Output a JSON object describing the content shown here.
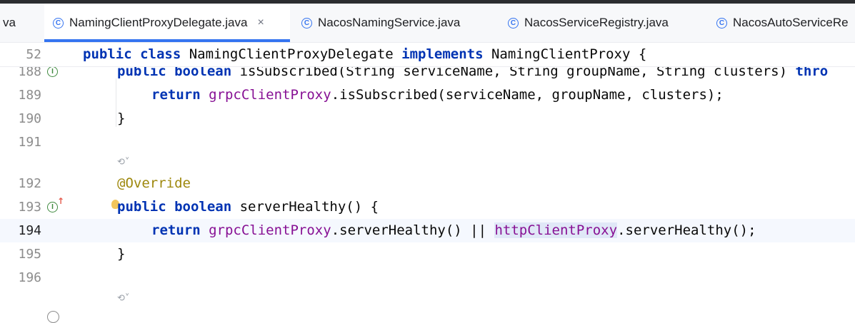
{
  "tabs": [
    {
      "label": "va",
      "icon": null,
      "active": false
    },
    {
      "label": "NamingClientProxyDelegate.java",
      "icon": "class-icon",
      "active": true,
      "close": "×"
    },
    {
      "label": "NacosNamingService.java",
      "icon": "class-icon",
      "active": false
    },
    {
      "label": "NacosServiceRegistry.java",
      "icon": "class-icon",
      "active": false
    },
    {
      "label": "NacosAutoServiceRe",
      "icon": "class-icon",
      "active": false
    }
  ],
  "class_icon_glyph": "C",
  "gutter_icon_glyph": "I",
  "editor": {
    "sticky_line": {
      "num": "52",
      "kw1": "public class",
      "name": " NamingClientProxyDelegate ",
      "kw2": "implements",
      "rest": " NamingClientProxy {"
    },
    "lines": [
      {
        "num": "188",
        "kw": "public boolean",
        "rest": " isSubscribed(String serviceName, String groupName, String clusters) ",
        "kw_tail": "thro"
      },
      {
        "num": "189",
        "kw": "return",
        "field": "grpcClientProxy",
        "rest": ".isSubscribed(serviceName, groupName, clusters);"
      },
      {
        "num": "190",
        "text": "}"
      },
      {
        "num": "191",
        "text": ""
      },
      {
        "num": "192",
        "annotation": "@Override"
      },
      {
        "num": "193",
        "kw": "public boolean",
        "rest": " serverHealthy() {"
      },
      {
        "num": "194",
        "kw": "return",
        "field": "grpcClientProxy",
        "mid": ".serverHealthy() || ",
        "field2": "httpClientProxy",
        "rest": ".serverHealthy();"
      },
      {
        "num": "195",
        "text": "}"
      },
      {
        "num": "196",
        "text": ""
      }
    ],
    "inlay_hint": "⟲˅"
  },
  "colors": {
    "accent": "#3574f0",
    "keyword": "#0033b3",
    "field": "#871094",
    "annotation": "#9e880d"
  }
}
